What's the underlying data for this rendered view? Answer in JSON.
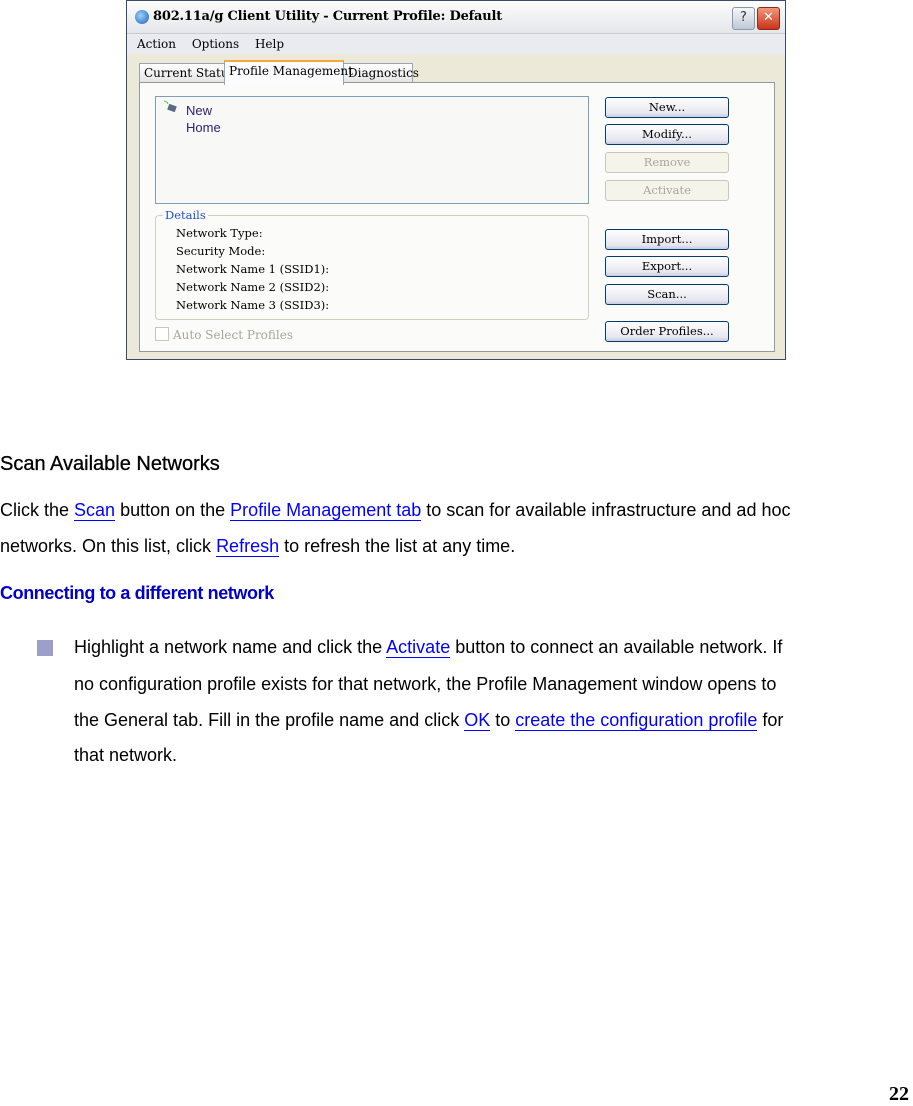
{
  "window": {
    "title": "802.11a/g Client Utility - Current Profile: Default",
    "help_btn": "?",
    "close_btn": "✕",
    "menu": [
      "Action",
      "Options",
      "Help"
    ],
    "tabs": [
      "Current Status",
      "Profile Management",
      "Diagnostics"
    ],
    "active_tab": "Profile Management",
    "profiles": [
      "New",
      "Home"
    ],
    "buttons": {
      "new": "New...",
      "modify": "Modify...",
      "remove": "Remove",
      "activate": "Activate",
      "import": "Import...",
      "export": "Export...",
      "scan": "Scan...",
      "order": "Order Profiles..."
    },
    "details": {
      "legend": "Details",
      "rows": [
        "Network Type:",
        "Security Mode:",
        "Network Name 1 (SSID1):",
        "Network Name 2 (SSID2):",
        "Network Name 3 (SSID3):"
      ]
    },
    "auto_select": "Auto Select Profiles"
  },
  "doc": {
    "heading": "Scan Available Networks",
    "p1": {
      "a": "Click the ",
      "scan": "Scan",
      "b": " button on the ",
      "pm": "Profile Management tab",
      "c": " to scan for available infrastructure and ad hoc",
      "d": "networks. On this list, click ",
      "refresh": "Refresh",
      "e": " to refresh the list at any time."
    },
    "subheading": "Connecting to a different network",
    "bullet": {
      "a": "Highlight a network name and click the ",
      "activate": "Activate",
      "b": " button to connect an available network. If",
      "c": "no configuration profile exists for that network, the Profile Management window opens to",
      "d": "the General tab.   Fill in the profile name and click ",
      "ok": "OK",
      "e": " to ",
      "create": "create the configuration profile",
      "f": " for",
      "g": "that network."
    },
    "page_number": "22"
  },
  "colors": {
    "link": "#0000ff",
    "subheading": "#0000cc",
    "bullet": "#9e9ecb"
  }
}
